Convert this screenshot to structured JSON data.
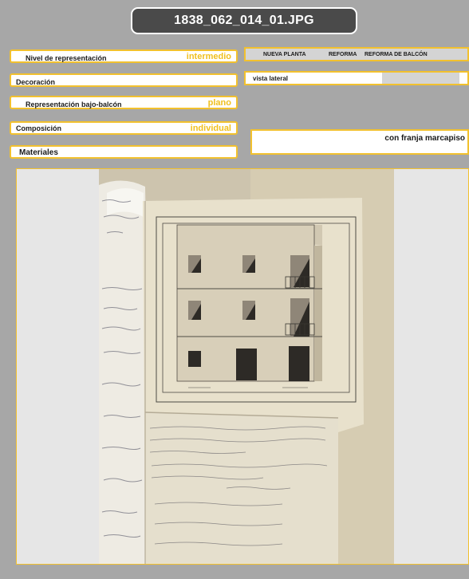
{
  "filename": "1838_062_014_01.JPG",
  "fields": {
    "nivel": {
      "label": "Nivel de representación",
      "value": "intermedio"
    },
    "decoracion": {
      "label": "Decoración",
      "value": ""
    },
    "bajo_balcon": {
      "label": "Representación bajo-balcón",
      "value": "plano"
    },
    "composicion": {
      "label": "Composición",
      "value": "individual"
    },
    "materiales": {
      "label": "Materiales",
      "value": ""
    }
  },
  "tabs": [
    "NUEVA PLANTA",
    "REFORMA",
    "REFORMA DE BALCÓN"
  ],
  "vista": "vista lateral",
  "franja": "con franja marcapiso",
  "colors": {
    "accent": "#f2c12e",
    "panel": "#a7a7a7",
    "title_bg": "#4a4a4a"
  }
}
